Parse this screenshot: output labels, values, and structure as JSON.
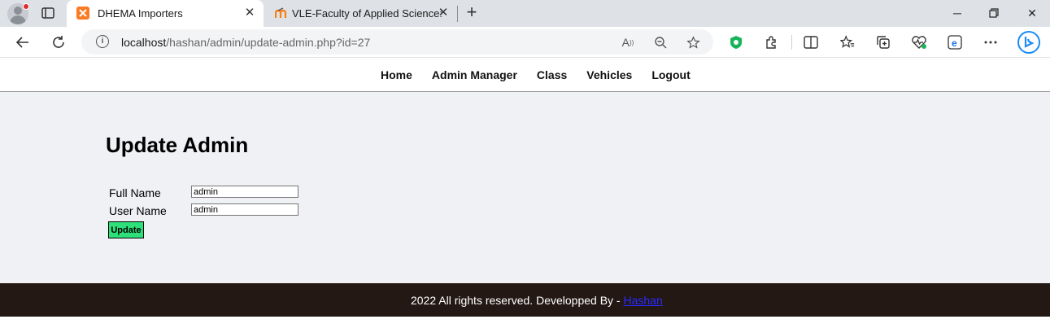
{
  "browser": {
    "tabs": [
      {
        "title": "DHEMA Importers",
        "active": true,
        "favicon": "xampp-icon"
      },
      {
        "title": "VLE-Faculty of Applied Science: L",
        "active": false,
        "favicon": "moodle-icon"
      }
    ],
    "url": {
      "host": "localhost",
      "path": "/hashan/admin/update-admin.php?id=27"
    }
  },
  "nav": {
    "items": [
      "Home",
      "Admin Manager",
      "Class",
      "Vehicles",
      "Logout"
    ]
  },
  "main": {
    "heading": "Update Admin",
    "fields": [
      {
        "label": "Full Name",
        "value": "admin"
      },
      {
        "label": "User Name",
        "value": "admin"
      }
    ],
    "submit_label": "Update"
  },
  "footer": {
    "text": "2022 All rights reserved. Developped By - ",
    "link_text": "Hashan"
  },
  "colors": {
    "update_button": "#2ee07a",
    "footer_bg": "#231814",
    "content_bg": "#f0f1f5",
    "footer_link": "#2a2aff"
  }
}
